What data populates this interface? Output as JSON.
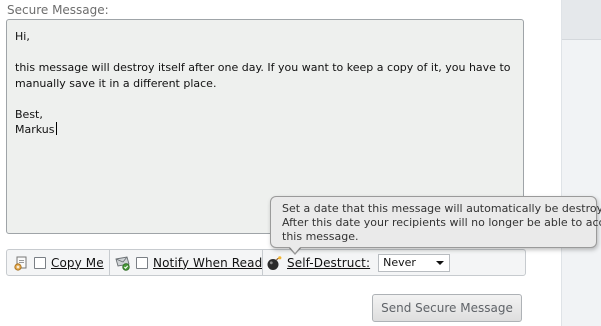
{
  "form": {
    "label": "Secure Message:",
    "message_lines": [
      "Hi,",
      "",
      "this message will destroy itself after one day. If you want to keep a copy of it, you have to",
      "manually save it in a different place.",
      "",
      "Best,",
      "Markus"
    ]
  },
  "toolbar": {
    "copy_me": {
      "label": "Copy Me",
      "checked": false,
      "icon": "copy-icon"
    },
    "notify_when_read": {
      "label": "Notify When Read",
      "checked": false,
      "icon": "notify-icon"
    },
    "self_destruct": {
      "label": "Self-Destruct:",
      "icon": "bomb-icon",
      "selected": "Never"
    }
  },
  "tooltip": {
    "lines": [
      "Set a date that this message will automatically be destroyed.",
      "After this date your recipients will no longer be able to access",
      "this message."
    ]
  },
  "actions": {
    "send_label": "Send Secure Message"
  },
  "colors": {
    "message_bg": "#eef0ee",
    "tooltip_bg": "#eaeaea",
    "border": "#9fa4a8"
  }
}
